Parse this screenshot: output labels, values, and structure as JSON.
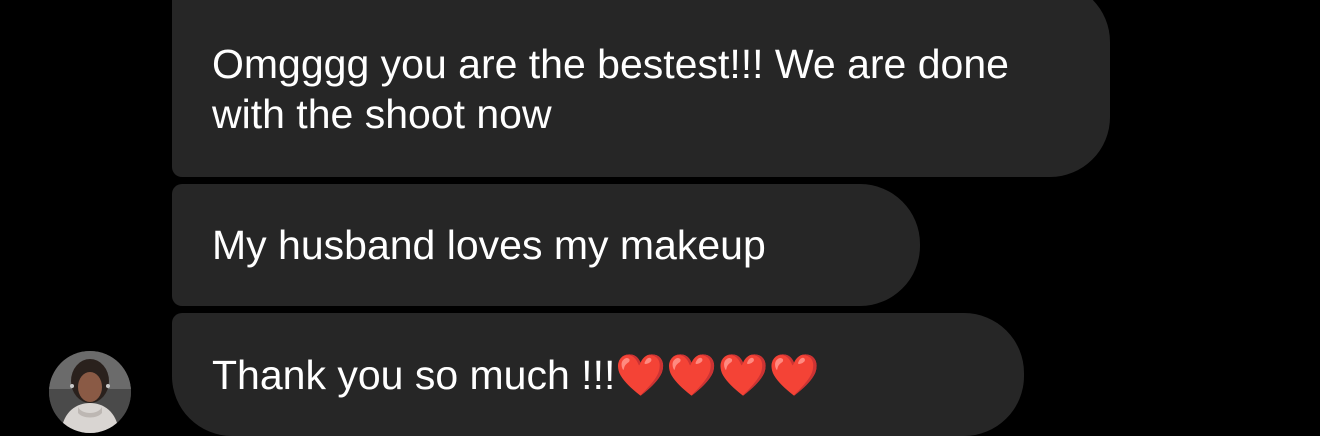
{
  "conversation": {
    "messages": [
      {
        "text": "Omgggg you are the bestest!!! We are done with the shoot now"
      },
      {
        "text": "My husband loves my makeup"
      },
      {
        "text": "Thank you so much !!!❤️❤️❤️❤️"
      }
    ]
  },
  "sender": {
    "avatar_icon": "profile-photo-avatar"
  },
  "colors": {
    "background": "#000000",
    "bubble": "#262626",
    "text": "#ffffff",
    "heart": "#e3262f"
  }
}
